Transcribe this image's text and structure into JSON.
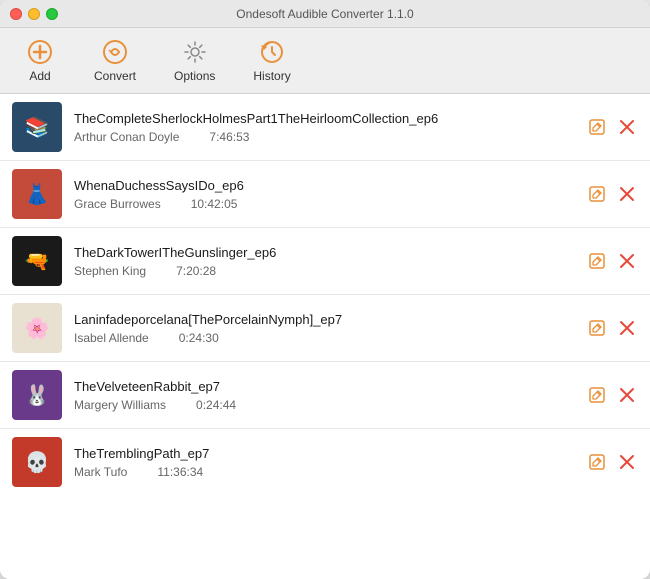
{
  "window": {
    "title": "Ondesoft Audible Converter 1.1.0"
  },
  "toolbar": {
    "add_label": "Add",
    "convert_label": "Convert",
    "options_label": "Options",
    "history_label": "History"
  },
  "items": [
    {
      "id": 1,
      "title": "TheCompleteSherlockHolmesPart1TheHeirloomCollection_ep6",
      "author": "Arthur Conan Doyle",
      "duration": "7:46:53",
      "art_emoji": "📚",
      "art_class": "art-1"
    },
    {
      "id": 2,
      "title": "WhenaDuchessSaysIDo_ep6",
      "author": "Grace Burrowes",
      "duration": "10:42:05",
      "art_emoji": "👗",
      "art_class": "art-2"
    },
    {
      "id": 3,
      "title": "TheDarkTowerITheGunslinger_ep6",
      "author": "Stephen King",
      "duration": "7:20:28",
      "art_emoji": "🔫",
      "art_class": "art-3"
    },
    {
      "id": 4,
      "title": "Laninfadeporcelana[ThePorcelainNymph]_ep7",
      "author": "Isabel Allende",
      "duration": "0:24:30",
      "art_emoji": "🌸",
      "art_class": "art-4"
    },
    {
      "id": 5,
      "title": "TheVelveteenRabbit_ep7",
      "author": "Margery Williams",
      "duration": "0:24:44",
      "art_emoji": "🐰",
      "art_class": "art-5"
    },
    {
      "id": 6,
      "title": "TheTremblingPath_ep7",
      "author": "Mark Tufo",
      "duration": "11:36:34",
      "art_emoji": "💀",
      "art_class": "art-6"
    }
  ]
}
